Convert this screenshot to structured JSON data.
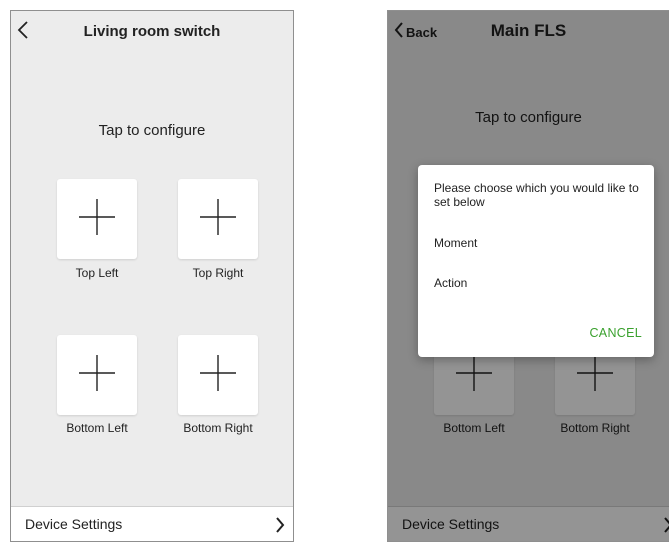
{
  "left_screen": {
    "title": "Living room switch",
    "prompt": "Tap to configure",
    "buttons": [
      {
        "label": "Top Left"
      },
      {
        "label": "Top Right"
      },
      {
        "label": "Bottom Left"
      },
      {
        "label": "Bottom Right"
      }
    ],
    "footer": {
      "label": "Device Settings"
    }
  },
  "right_screen": {
    "back_label": "Back",
    "title": "Main FLS",
    "prompt": "Tap to configure",
    "buttons": [
      {
        "label": "Bottom Left"
      },
      {
        "label": "Bottom Right"
      }
    ],
    "footer": {
      "label": "Device Settings"
    },
    "dialog": {
      "message": "Please choose which you would like to set below",
      "options": [
        "Moment",
        "Action"
      ],
      "cancel_label": "CANCEL"
    }
  },
  "colors": {
    "screen_background": "#ececec",
    "tile_background": "#ffffff",
    "overlay": "rgba(0,0,0,0.42)",
    "cancel_accent": "#3aa12e"
  },
  "icons": [
    "chevron-left-icon",
    "plus-icon",
    "chevron-right-icon"
  ]
}
